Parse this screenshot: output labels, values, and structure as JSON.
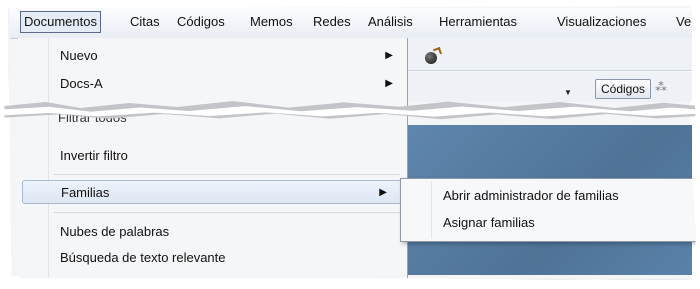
{
  "menubar": {
    "items": [
      {
        "label": "Documentos"
      },
      {
        "label": "Citas"
      },
      {
        "label": "Códigos"
      },
      {
        "label": "Memos"
      },
      {
        "label": "Redes"
      },
      {
        "label": "Análisis"
      },
      {
        "label": "Herramientas"
      },
      {
        "label": "Visualizaciones"
      },
      {
        "label": "Ve"
      }
    ],
    "open_item": "Documentos"
  },
  "toolbar": {
    "codigos_button": "Códigos"
  },
  "documentos_menu": {
    "items": [
      {
        "label": "Nuevo",
        "has_submenu": true
      },
      {
        "label": "Docs-A",
        "has_submenu": true
      },
      {
        "label": "Invertir filtro",
        "has_submenu": false
      },
      {
        "label": "Familias",
        "has_submenu": true,
        "highlighted": true
      },
      {
        "label": "Nubes de palabras",
        "has_submenu": false
      },
      {
        "label": "Búsqueda de texto relevante",
        "has_submenu": false
      }
    ],
    "partially_hidden_label": "Filtrar todos"
  },
  "familias_submenu": {
    "items": [
      {
        "label": "Abrir administrador de familias"
      },
      {
        "label": "Asignar familias"
      }
    ]
  },
  "colors": {
    "menu_background": "#f5f6f8",
    "highlight": "#dde6f3",
    "content_pane": "#5f86ad"
  }
}
